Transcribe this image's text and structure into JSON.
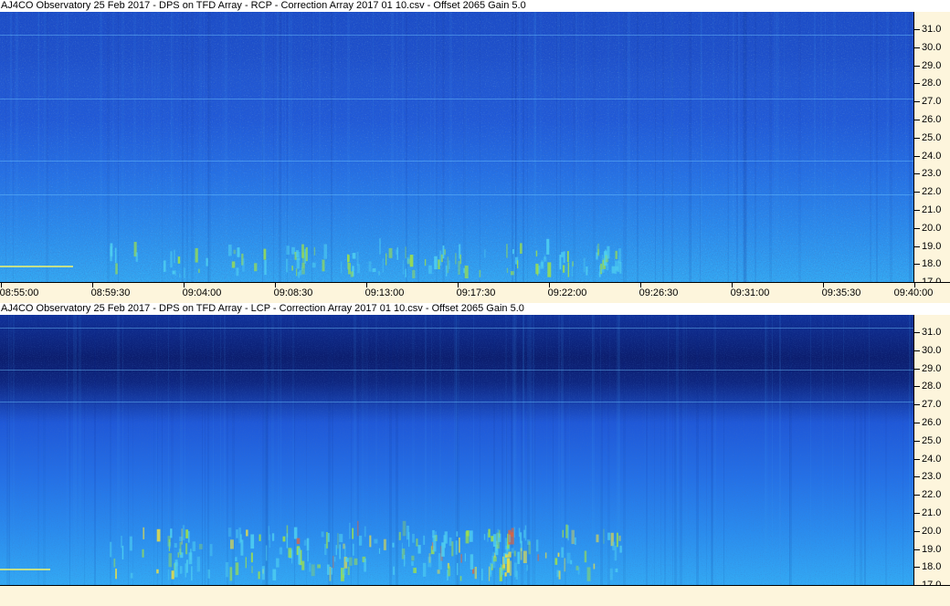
{
  "panels": [
    {
      "id": "rcp",
      "title": "AJ4CO Observatory 25 Feb 2017  -  DPS on TFD Array  -  RCP  -  Correction Array 2017 01 10.csv  -  Offset 2065  Gain 5.0",
      "noise_level": 0.55,
      "dark_band_strength": 0.15,
      "burst_strength": 0.55
    },
    {
      "id": "lcp",
      "title": "AJ4CO Observatory 25 Feb 2017  -  DPS on TFD Array  -  LCP  -  Correction Array 2017 01 10.csv  -  Offset 2065  Gain 5.0",
      "noise_level": 0.45,
      "dark_band_strength": 0.75,
      "burst_strength": 1.0
    }
  ],
  "frequency_axis": {
    "unit": "MHz",
    "labels": [
      "31.0",
      "30.0",
      "29.0",
      "28.0",
      "27.0",
      "26.0",
      "25.0",
      "24.0",
      "23.0",
      "22.0",
      "21.0",
      "20.0",
      "19.0",
      "18.0",
      "17.0"
    ]
  },
  "time_axis": {
    "labels": [
      "08:55:00",
      "08:59:30",
      "09:04:00",
      "09:08:30",
      "09:13:00",
      "09:17:30",
      "09:22:00",
      "09:26:30",
      "09:31:00",
      "09:35:30",
      "09:40:00"
    ]
  },
  "colors": {
    "background": "#fdf5dc",
    "title_background": "#ffffff",
    "spectrum_low": "#0a1a7a",
    "spectrum_mid": "#1f5fe0",
    "spectrum_high": "#35b4f0",
    "burst_green": "#9ee04a",
    "burst_yellow": "#f0e040",
    "burst_red": "#f06030"
  }
}
